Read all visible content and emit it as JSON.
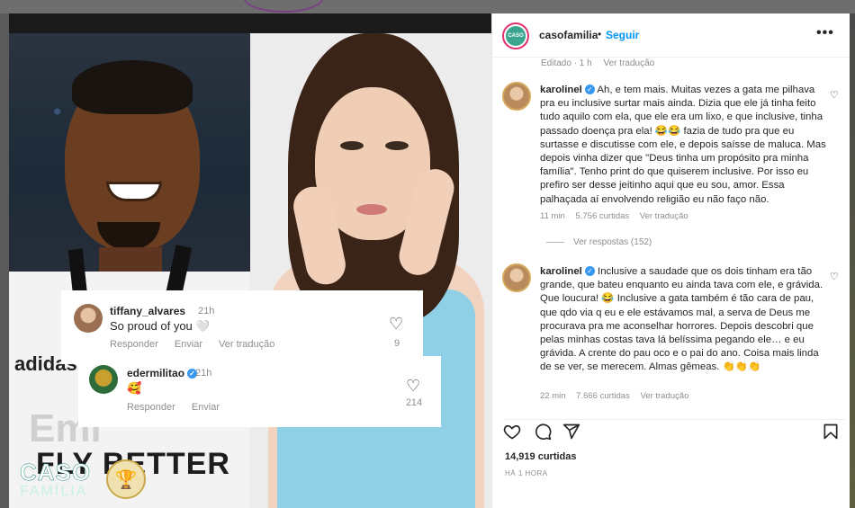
{
  "post": {
    "account": "casofamilia",
    "follow_label": "Seguir",
    "separator": "•",
    "more_label": "•••",
    "edited": "Editado · 1 h",
    "see_translation": "Ver tradução",
    "brand_logo": {
      "line1": "CASO",
      "line2": "FAMÍLIA"
    },
    "avatar_text": "CASO FAMÍLIA",
    "image_overlay_text": {
      "brand": "adidas",
      "jersey_big": "Emi",
      "jersey_sponsor": "FLY BETTER"
    }
  },
  "overlay_comments": [
    {
      "user": "tiffany_alvares",
      "time": "21h",
      "text": "So proud of you 🤍",
      "actions": [
        "Responder",
        "Enviar",
        "Ver tradução"
      ],
      "likes": "9"
    },
    {
      "user": "edermilitao",
      "verified": true,
      "time": "21h",
      "text": "🥰",
      "actions": [
        "Responder",
        "Enviar"
      ],
      "likes": "214"
    }
  ],
  "comments": [
    {
      "user": "karolinel",
      "verified": true,
      "text": "Ah, e tem mais. Muitas vezes a gata me pilhava pra eu inclusive surtar mais ainda. Dizia que ele já tinha feito tudo aquilo com ela, que ele era um lixo, e que inclusive, tinha passado doença pra ela! 😂😂 fazia de tudo pra que eu surtasse e discutisse com ele, e depois saísse de maluca. Mas depois vinha dizer que \"Deus tinha um propósito pra minha família\". Tenho print do que quiserem inclusive. Por isso eu prefiro ser desse jeitinho aqui que eu sou, amor. Essa palhaçada aí envolvendo religião eu não faço não.",
      "time": "11 min",
      "likes": "5.756 curtidas",
      "translate": "Ver tradução"
    },
    {
      "user": "karolinel",
      "verified": true,
      "text": "Inclusive a saudade que os dois tinham era tão grande, que bateu enquanto eu ainda tava com ele, e grávida. Que loucura! 😂 Inclusive a gata também é tão cara de pau, que qdo via q eu e ele estávamos mal, a serva de Deus me procurava pra me aconselhar horrores. Depois descobri que pelas minhas costas tava lá belíssima pegando ele… e eu grávida. A crente do pau oco e o pai do ano. Coisa mais linda de se ver, se merecem. Almas gêmeas. 👏👏👏",
      "time": "22 min",
      "likes": "7.666 curtidas",
      "translate": "Ver tradução"
    }
  ],
  "replies_label": "Ver respostas (152)",
  "footer": {
    "likes": "14,919 curtidas",
    "ago": "HÁ 1 HORA"
  },
  "icons": [
    "heart-icon",
    "comment-icon",
    "share-icon",
    "bookmark-icon",
    "more-icon",
    "verified-icon"
  ],
  "colors": {
    "link": "#0095f6",
    "text": "#262626",
    "muted": "#8e8e8e",
    "verified": "#3897f0"
  }
}
